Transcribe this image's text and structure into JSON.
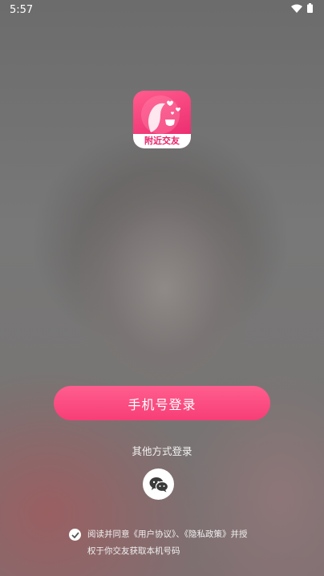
{
  "status_bar": {
    "time": "5:57",
    "wifi_icon": "wifi-icon",
    "battery_icon": "battery-icon"
  },
  "logo": {
    "caption": "附近交友",
    "icon": "app-logo-icon"
  },
  "login": {
    "phone_login_label": "手机号登录",
    "other_methods_label": "其他方式登录",
    "wechat_icon": "wechat-icon"
  },
  "agreement": {
    "line1": "阅读并同意《用户协议》、《隐私政策》并授",
    "line2": "权于你交友获取本机号码",
    "checked": true
  },
  "colors": {
    "accent": "#f84a7e",
    "logo_pink": "#e8246a"
  }
}
